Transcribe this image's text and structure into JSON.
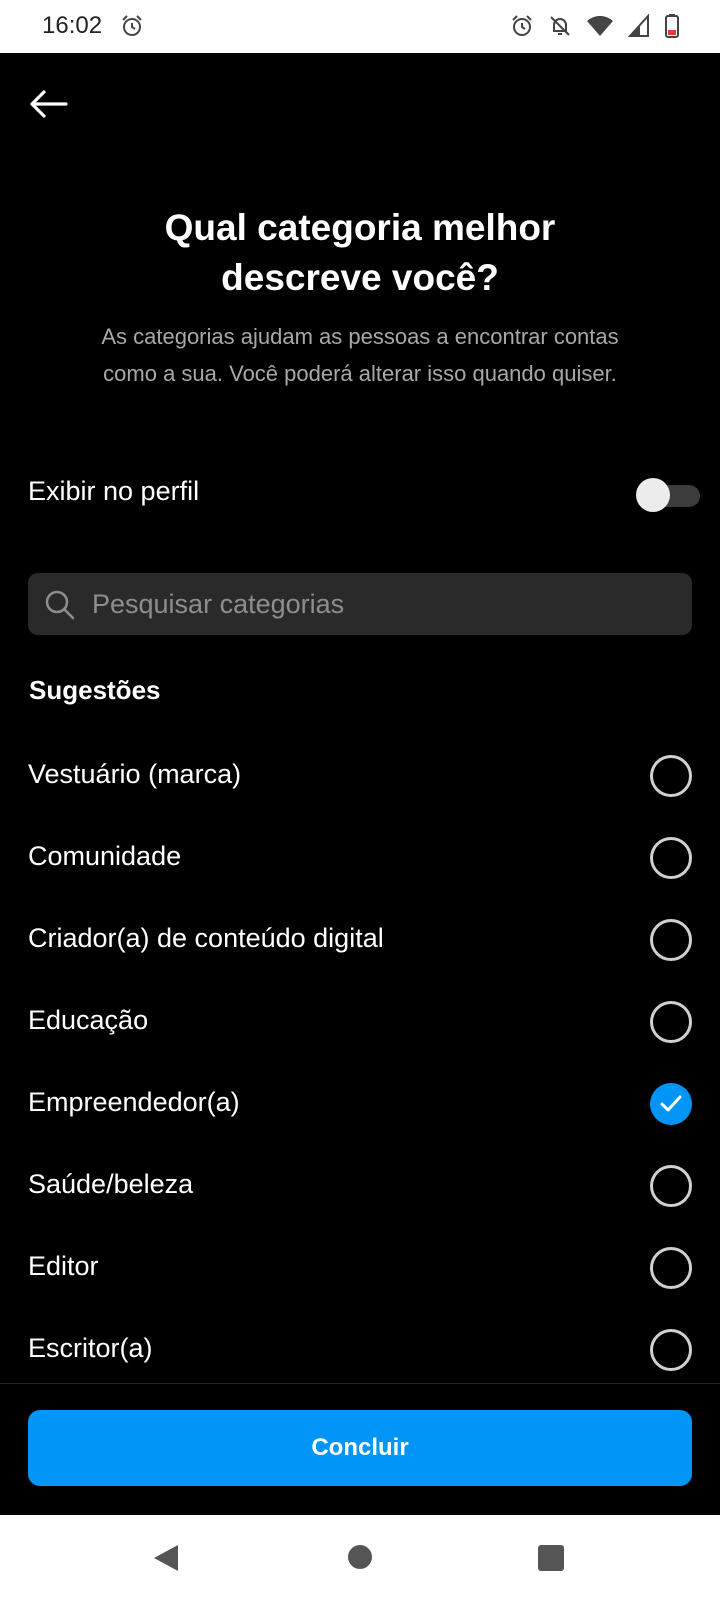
{
  "status_bar": {
    "time": "16:02",
    "icons": [
      "alarm-icon",
      "alarm-icon",
      "notifications-off-icon",
      "wifi-icon",
      "signal-icon",
      "battery-icon"
    ]
  },
  "header": {
    "back_icon": "arrow-left-icon",
    "title_line1": "Qual categoria melhor",
    "title_line2": "descreve você?",
    "subtitle_line1": "As categorias ajudam as pessoas a encontrar contas",
    "subtitle_line2": "como a sua. Você poderá alterar isso quando quiser."
  },
  "profile_toggle": {
    "label": "Exibir no perfil",
    "on": false
  },
  "search": {
    "placeholder": "Pesquisar categorias",
    "value": ""
  },
  "suggestions": {
    "title": "Sugestões",
    "items": [
      {
        "label": "Vestuário (marca)",
        "selected": false
      },
      {
        "label": "Comunidade",
        "selected": false
      },
      {
        "label": "Criador(a) de conteúdo digital",
        "selected": false
      },
      {
        "label": "Educação",
        "selected": false
      },
      {
        "label": "Empreendedor(a)",
        "selected": true
      },
      {
        "label": "Saúde/beleza",
        "selected": false
      },
      {
        "label": "Editor",
        "selected": false
      },
      {
        "label": "Escritor(a)",
        "selected": false
      }
    ]
  },
  "footer": {
    "done_label": "Concluir"
  },
  "colors": {
    "accent": "#0095f6",
    "background": "#000000",
    "search_bg": "#2a2a2a"
  }
}
